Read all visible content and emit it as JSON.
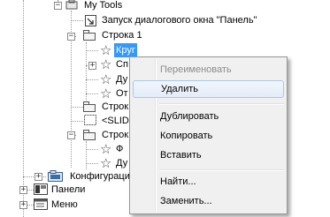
{
  "tree": {
    "my_tools": "My Tools",
    "launch_panel": "Запуск диалогового окна \"Панель\"",
    "row1": "Строка 1",
    "krug": "Круг",
    "child_a": "Сп",
    "child_b": "Ду",
    "child_c": "От",
    "row2": "Строк",
    "slider": "<SLID",
    "row3": "Строк",
    "child_d": "Ф",
    "child_e": "Ду",
    "configs": "Конфигурация",
    "panels": "Панели",
    "menu": "Меню"
  },
  "context_menu": {
    "items": [
      {
        "label": "Переименовать",
        "enabled": false
      },
      {
        "label": "Удалить",
        "enabled": true,
        "highlighted": true
      },
      {
        "label": "Дублировать",
        "enabled": true
      },
      {
        "label": "Копировать",
        "enabled": true
      },
      {
        "label": "Вставить",
        "enabled": true
      },
      {
        "label": "Найти...",
        "enabled": true
      },
      {
        "label": "Заменить...",
        "enabled": true
      }
    ]
  },
  "colors": {
    "selection": "#3399ff",
    "menu_bg": "#f0f0f0",
    "menu_hover_border": "#a8c8ec"
  }
}
